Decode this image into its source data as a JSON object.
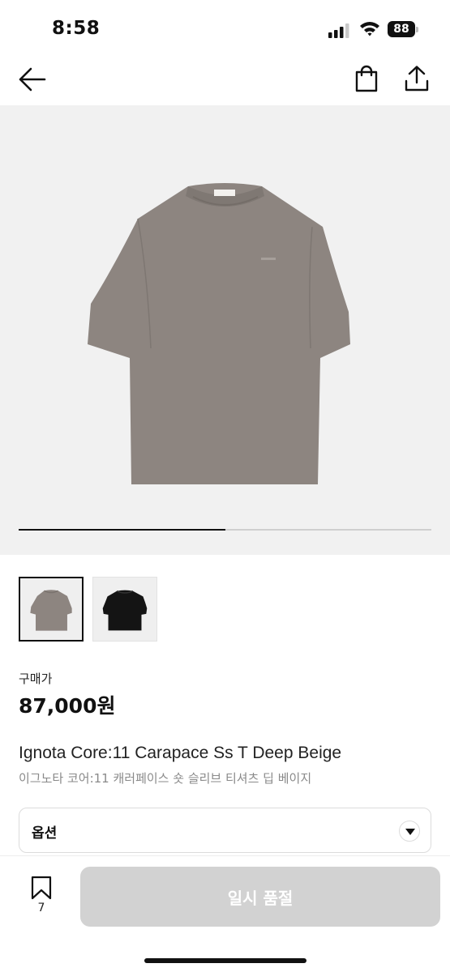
{
  "status_bar": {
    "time": "8:58",
    "battery": "88"
  },
  "hero": {
    "image": "t-shirt-deep-beige-photo",
    "progress": 0.5
  },
  "thumbnails": [
    {
      "icon": "t-shirt-beige-thumbnail",
      "selected": true
    },
    {
      "icon": "t-shirt-black-thumbnail",
      "selected": false
    }
  ],
  "product": {
    "price_label": "구매가",
    "price": "87,000원",
    "name": "Ignota Core:11 Carapace Ss T Deep Beige",
    "name_ko": "이그노타 코어:11 캐러페이스 숏 슬리브 티셔츠 딥 베이지"
  },
  "option": {
    "label": "옵션"
  },
  "bottom_bar": {
    "bookmark_count": "7",
    "button_label": "일시 품절"
  },
  "colors": {
    "shirt_beige": "#8d8580",
    "shirt_black": "#141414",
    "button_disabled": "#d2d2d2",
    "hero_bg": "#f1f1f1"
  }
}
